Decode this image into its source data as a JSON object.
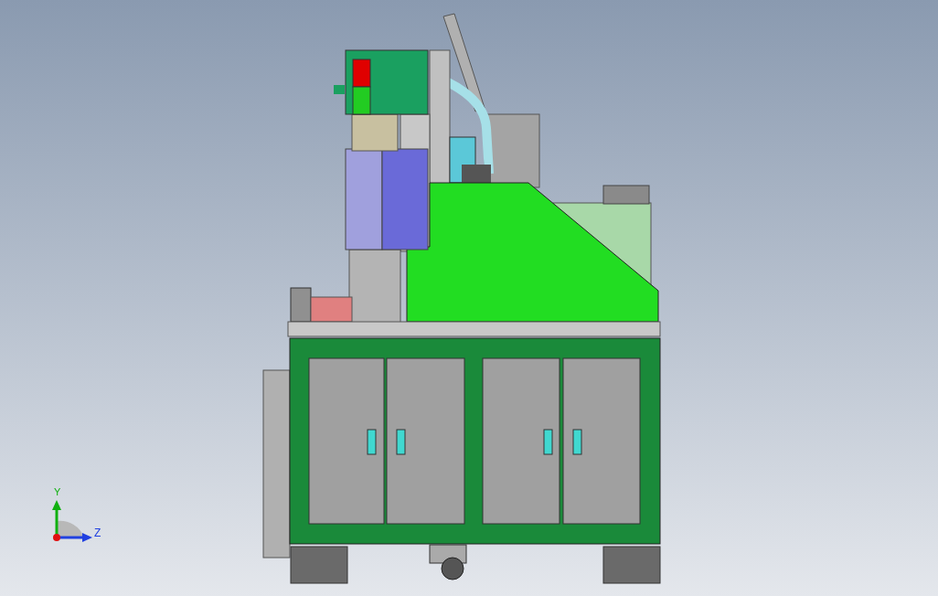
{
  "viewport": {
    "triad": {
      "labels": [
        "Y",
        "Z"
      ]
    }
  }
}
